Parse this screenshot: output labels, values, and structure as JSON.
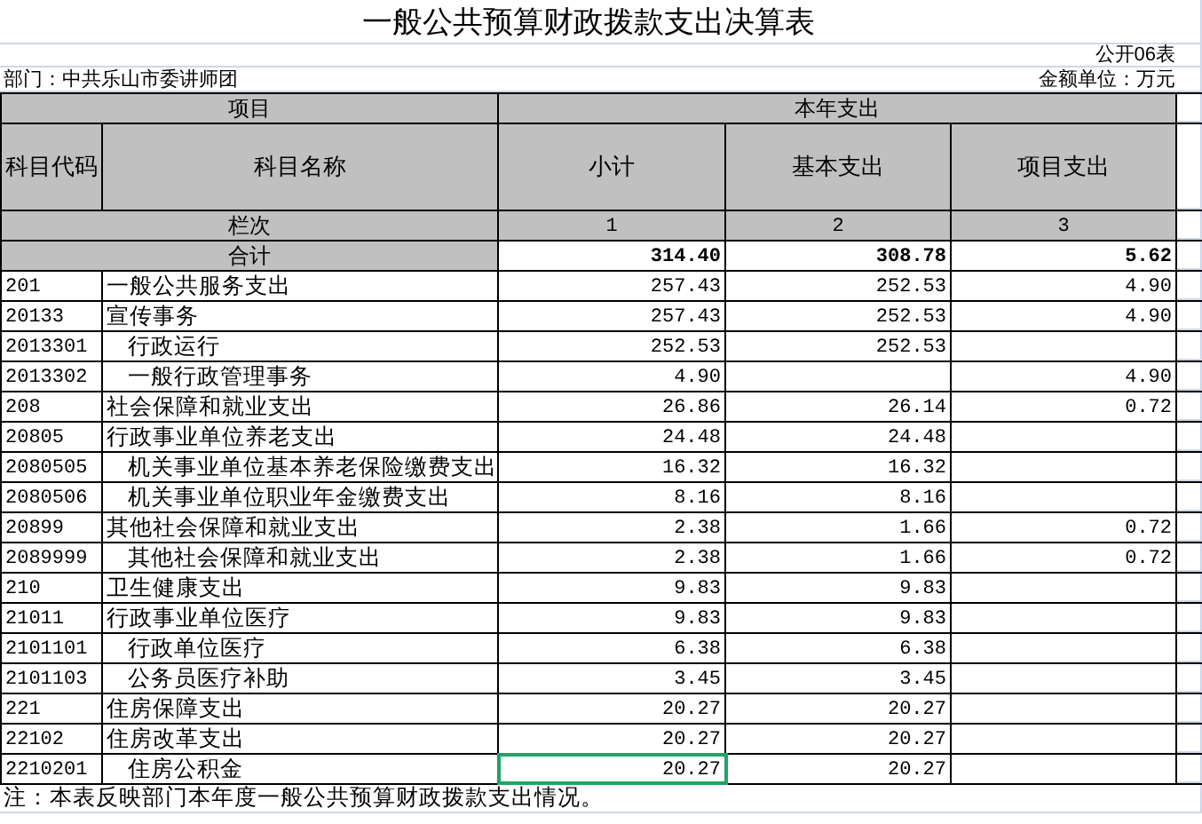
{
  "title": "一般公共预算财政拨款支出决算表",
  "form_no": "公开06表",
  "department": "部门：中共乐山市委讲师团",
  "unit": "金额单位：万元",
  "header": {
    "item": "项目",
    "current_year": "本年支出",
    "columns": [
      "科目代码",
      "科目名称",
      "小计",
      "基本支出",
      "项目支出"
    ],
    "line_label": "栏次",
    "line_numbers": [
      "1",
      "2",
      "3"
    ]
  },
  "total": {
    "label": "合计",
    "values": [
      "314.40",
      "308.78",
      "5.62"
    ]
  },
  "rows": [
    {
      "code": "201",
      "name": "一般公共服务支出",
      "subtotal": "257.43",
      "basic": "252.53",
      "project": "4.90",
      "selected": false,
      "children": [
        {
          "code": "20133",
          "name": "宣传事务",
          "subtotal": "257.43",
          "basic": "252.53",
          "project": "4.90",
          "selected": false,
          "children": [
            {
              "code": "2013301",
              "name": "行政运行",
              "subtotal": "252.53",
              "basic": "252.53",
              "selected": false
            },
            {
              "code": "2013302",
              "name": "一般行政管理事务",
              "subtotal": "4.90",
              "project": "4.90",
              "selected": false
            }
          ]
        }
      ]
    },
    {
      "code": "208",
      "name": "社会保障和就业支出",
      "subtotal": "26.86",
      "basic": "26.14",
      "project": "0.72",
      "selected": false,
      "children": [
        {
          "code": "20805",
          "name": "行政事业单位养老支出",
          "subtotal": "24.48",
          "basic": "24.48",
          "selected": false,
          "children": [
            {
              "code": "2080505",
              "name": "机关事业单位基本养老保险缴费支出",
              "subtotal": "16.32",
              "basic": "16.32",
              "selected": false
            },
            {
              "code": "2080506",
              "name": "机关事业单位职业年金缴费支出",
              "subtotal": "8.16",
              "basic": "8.16",
              "selected": false
            }
          ]
        },
        {
          "code": "20899",
          "name": "其他社会保障和就业支出",
          "subtotal": "2.38",
          "basic": "1.66",
          "project": "0.72",
          "selected": false,
          "children": [
            {
              "code": "2089999",
              "name": "其他社会保障和就业支出",
              "subtotal": "2.38",
              "basic": "1.66",
              "project": "0.72",
              "selected": false
            }
          ]
        }
      ]
    },
    {
      "code": "210",
      "name": "卫生健康支出",
      "subtotal": "9.83",
      "basic": "9.83",
      "selected": false,
      "children": [
        {
          "code": "21011",
          "name": "行政事业单位医疗",
          "subtotal": "9.83",
          "basic": "9.83",
          "selected": false,
          "children": [
            {
              "code": "2101101",
              "name": "行政单位医疗",
              "subtotal": "6.38",
              "basic": "6.38",
              "selected": false
            },
            {
              "code": "2101103",
              "name": "公务员医疗补助",
              "subtotal": "3.45",
              "basic": "3.45",
              "selected": false
            }
          ]
        }
      ]
    },
    {
      "code": "221",
      "name": "住房保障支出",
      "subtotal": "20.27",
      "basic": "20.27",
      "selected": false,
      "children": [
        {
          "code": "22102",
          "name": "住房改革支出",
          "subtotal": "20.27",
          "basic": "20.27",
          "selected": false,
          "children": [
            {
              "code": "2210201",
              "name": "住房公积金",
              "subtotal": "20.27",
              "basic": "20.27",
              "selected": true
            }
          ]
        }
      ]
    }
  ],
  "note": "注：本表反映部门本年度一般公共预算财政拨款支出情况。"
}
